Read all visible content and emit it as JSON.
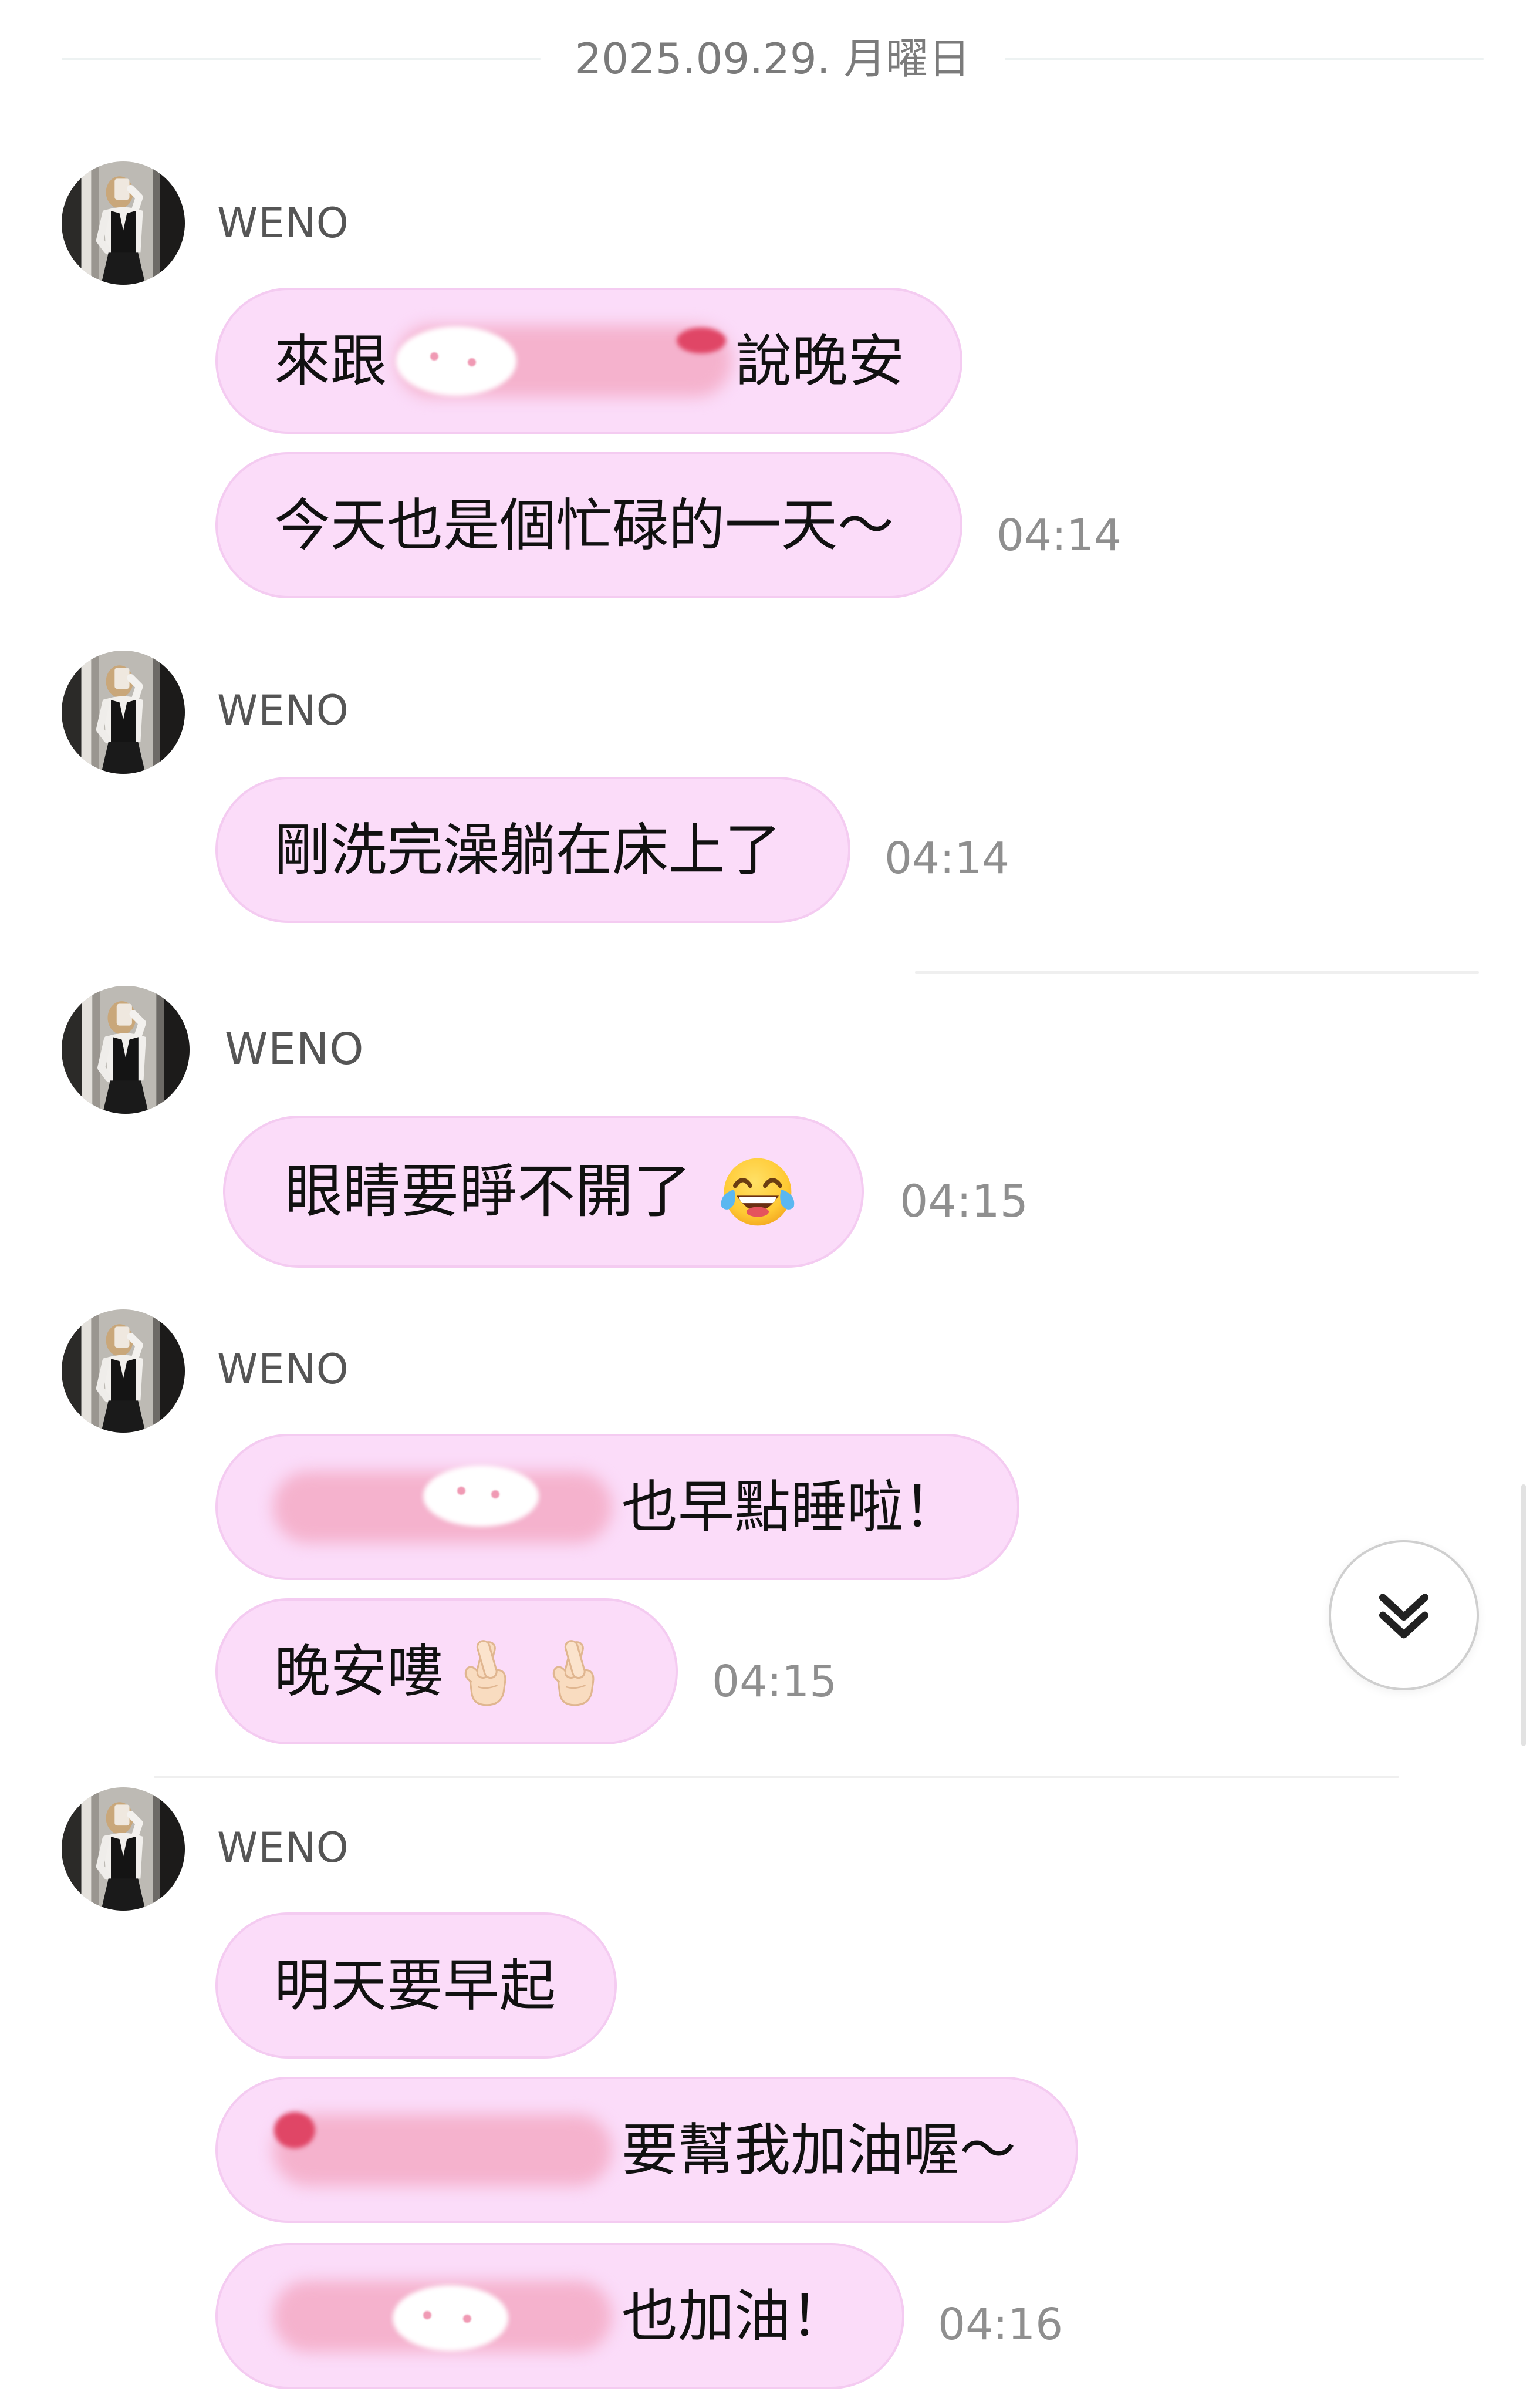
{
  "colors": {
    "bubble_background": "#fbdcf9",
    "bubble_border": "#f4cbf1",
    "message_text": "#111111",
    "sender_name": "#555555",
    "timestamp": "#8f8f8f",
    "date_text": "#7b7b7b"
  },
  "date_separator": {
    "label": "2025.09.29. 月曜日"
  },
  "groups": [
    {
      "sender": "WENO",
      "messages": [
        {
          "parts": [
            "來跟",
            "說晚安"
          ]
        },
        {
          "text": "今天也是個忙碌的一天～"
        }
      ],
      "time": "04:14"
    },
    {
      "sender": "WENO",
      "messages": [
        {
          "text": "剛洗完澡躺在床上了"
        }
      ],
      "time": "04:14"
    },
    {
      "sender": "WENO",
      "messages": [
        {
          "text": "眼睛要睜不開了",
          "emoji": [
            "face-with-tears-of-joy-icon"
          ]
        }
      ],
      "time": "04:15"
    },
    {
      "sender": "WENO",
      "messages": [
        {
          "text": "也早點睡啦！"
        },
        {
          "text": "晚安嘍",
          "emoji": [
            "crossed-fingers-icon",
            "crossed-fingers-icon"
          ]
        }
      ],
      "time": "04:15"
    },
    {
      "sender": "WENO",
      "messages": [
        {
          "text": "明天要早起"
        },
        {
          "text": "要幫我加油喔～"
        },
        {
          "text": "也加油！"
        }
      ],
      "time": "04:16"
    }
  ],
  "scroll_to_bottom_button": {
    "icon": "double-chevron-down-icon"
  }
}
